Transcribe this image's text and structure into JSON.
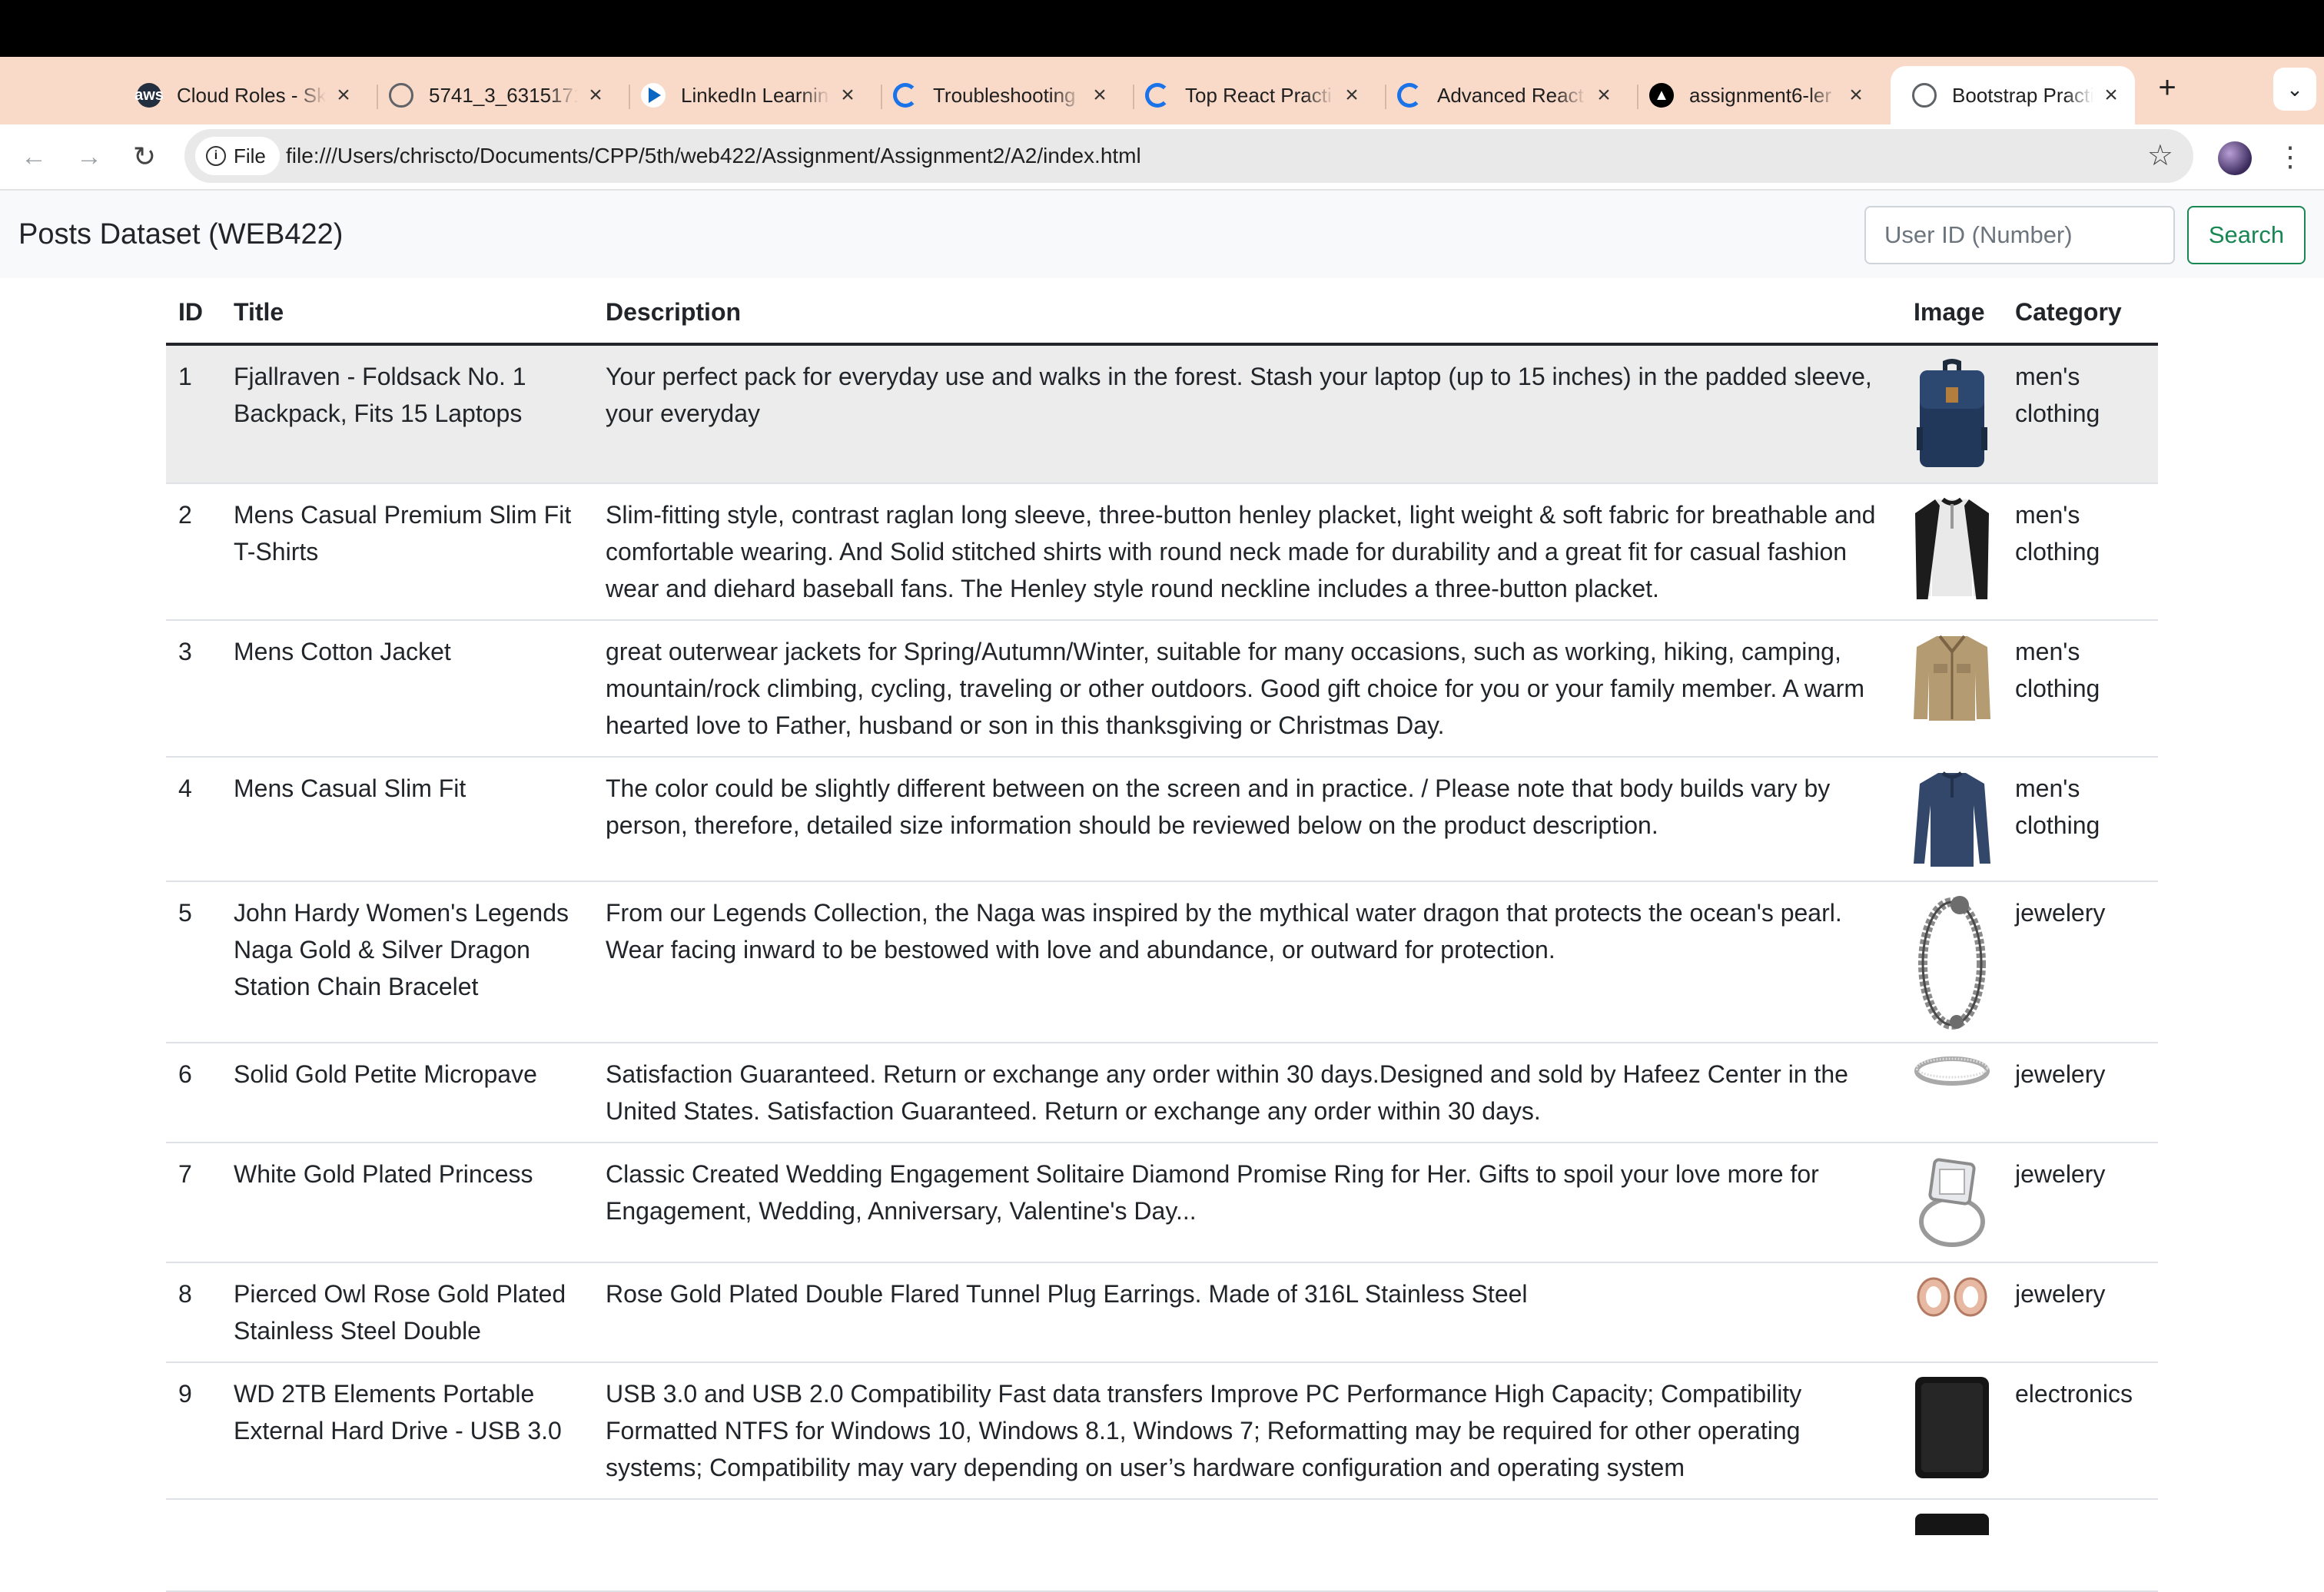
{
  "browser": {
    "tabs": [
      {
        "title": "Cloud Roles - Sk",
        "icon": "aws-icon"
      },
      {
        "title": "5741_3_6315171",
        "icon": "globe-icon"
      },
      {
        "title": "LinkedIn Learnin",
        "icon": "linkedin-learning-icon"
      },
      {
        "title": "Troubleshooting",
        "icon": "google-icon"
      },
      {
        "title": "Top React Practi",
        "icon": "google-icon"
      },
      {
        "title": "Advanced React",
        "icon": "google-icon"
      },
      {
        "title": "assignment6-ler",
        "icon": "vercel-icon"
      },
      {
        "title": "Bootstrap Practi",
        "icon": "globe-icon",
        "active": true
      }
    ],
    "chip_label": "File",
    "url": "file:///Users/chrisctо/Documents/CPP/5th/web422/Assignment/Assignment2/A2/index.html"
  },
  "app": {
    "brand": "Posts Dataset (WEB422)",
    "search": {
      "placeholder": "User ID (Number)",
      "value": "",
      "button": "Search"
    }
  },
  "table": {
    "headers": {
      "id": "ID",
      "title": "Title",
      "description": "Description",
      "image": "Image",
      "category": "Category"
    },
    "rows": [
      {
        "id": "1",
        "title": "Fjallraven - Foldsack No. 1 Backpack, Fits 15 Laptops",
        "description": "Your perfect pack for everyday use and walks in the forest. Stash your laptop (up to 15 inches) in the padded sleeve, your everyday",
        "category": "men's clothing",
        "image": "backpack-image"
      },
      {
        "id": "2",
        "title": "Mens Casual Premium Slim Fit T-Shirts",
        "description": "Slim-fitting style, contrast raglan long sleeve, three-button henley placket, light weight & soft fabric for breathable and comfortable wearing. And Solid stitched shirts with round neck made for durability and a great fit for casual fashion wear and diehard baseball fans. The Henley style round neckline includes a three-button placket.",
        "category": "men's clothing",
        "image": "tshirt-image"
      },
      {
        "id": "3",
        "title": "Mens Cotton Jacket",
        "description": "great outerwear jackets for Spring/Autumn/Winter, suitable for many occasions, such as working, hiking, camping, mountain/rock climbing, cycling, traveling or other outdoors. Good gift choice for you or your family member. A warm hearted love to Father, husband or son in this thanksgiving or Christmas Day.",
        "category": "men's clothing",
        "image": "jacket-image"
      },
      {
        "id": "4",
        "title": "Mens Casual Slim Fit",
        "description": "The color could be slightly different between on the screen and in practice. / Please note that body builds vary by person, therefore, detailed size information should be reviewed below on the product description.",
        "category": "men's clothing",
        "image": "longsleeve-image"
      },
      {
        "id": "5",
        "title": "John Hardy Women's Legends Naga Gold & Silver Dragon Station Chain Bracelet",
        "description": "From our Legends Collection, the Naga was inspired by the mythical water dragon that protects the ocean's pearl. Wear facing inward to be bestowed with love and abundance, or outward for protection.",
        "category": "jewelery",
        "image": "bracelet-image"
      },
      {
        "id": "6",
        "title": "Solid Gold Petite Micropave",
        "description": "Satisfaction Guaranteed. Return or exchange any order within 30 days.Designed and sold by Hafeez Center in the United States. Satisfaction Guaranteed. Return or exchange any order within 30 days.",
        "category": "jewelery",
        "image": "band-ring-image"
      },
      {
        "id": "7",
        "title": "White Gold Plated Princess",
        "description": "Classic Created Wedding Engagement Solitaire Diamond Promise Ring for Her. Gifts to spoil your love more for Engagement, Wedding, Anniversary, Valentine's Day...",
        "category": "jewelery",
        "image": "diamond-ring-image"
      },
      {
        "id": "8",
        "title": "Pierced Owl Rose Gold Plated Stainless Steel Double",
        "description": "Rose Gold Plated Double Flared Tunnel Plug Earrings. Made of 316L Stainless Steel",
        "category": "jewelery",
        "image": "earrings-image"
      },
      {
        "id": "9",
        "title": "WD 2TB Elements Portable External Hard Drive - USB 3.0",
        "description": "USB 3.0 and USB 2.0 Compatibility Fast data transfers Improve PC Performance High Capacity; Compatibility Formatted NTFS for Windows 10, Windows 8.1, Windows 7; Reformatting may be required for other operating systems; Compatibility may vary depending on user’s hardware configuration and operating system",
        "category": "electronics",
        "image": "hard-drive-image"
      },
      {
        "id": "",
        "title": "",
        "description": "",
        "category": "",
        "image": "partial-row-image"
      }
    ]
  }
}
